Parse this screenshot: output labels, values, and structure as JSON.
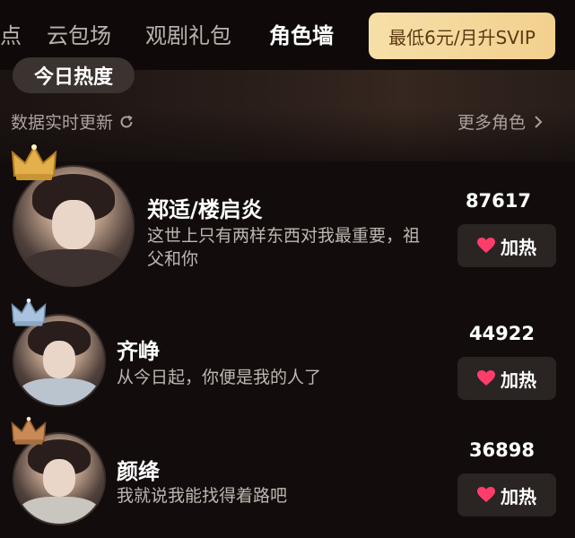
{
  "nav": {
    "tabs": [
      "点",
      "云包场",
      "观剧礼包",
      "角色墙"
    ],
    "active_tab": "角色墙",
    "vip_label": "最低6元/月升SVIP"
  },
  "header": {
    "today_label": "今日热度",
    "realtime_label": "数据实时更新",
    "more_label": "更多角色"
  },
  "characters": [
    {
      "rank_color": "#e3b04b",
      "name": "郑适/楼启炎",
      "quote": "这世上只有两样东西对我最重要，祖父和你",
      "score": "87617",
      "heat_label": "加热"
    },
    {
      "rank_color": "#a9c3df",
      "name": "齐峥",
      "quote": "从今日起，你便是我的人了",
      "score": "44922",
      "heat_label": "加热"
    },
    {
      "rank_color": "#c98a55",
      "name": "颜绛",
      "quote": "我就说我能找得着路吧",
      "score": "36898",
      "heat_label": "加热"
    }
  ],
  "icons": {
    "refresh": "refresh-icon",
    "chevron": "chevron-right-icon",
    "heart": "heart-icon",
    "crown": "crown-icon"
  },
  "colors": {
    "accent_heart": "#ff3d6b",
    "vip_gold": "#f6dfa8"
  }
}
